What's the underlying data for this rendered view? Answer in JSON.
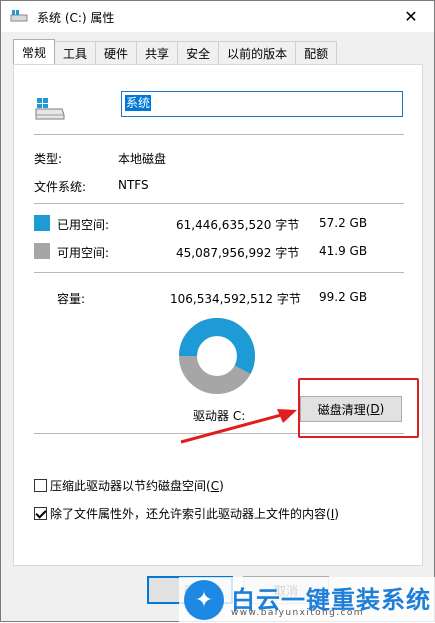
{
  "window": {
    "title": "系统 (C:) 属性",
    "close_glyph": "✕"
  },
  "tabs": [
    {
      "label": "常规",
      "active": true
    },
    {
      "label": "工具"
    },
    {
      "label": "硬件"
    },
    {
      "label": "共享"
    },
    {
      "label": "安全"
    },
    {
      "label": "以前的版本"
    },
    {
      "label": "配额"
    }
  ],
  "general": {
    "drive_name": "系统",
    "type_label": "类型:",
    "type_value": "本地磁盘",
    "fs_label": "文件系统:",
    "fs_value": "NTFS",
    "used": {
      "label": "已用空间:",
      "bytes": "61,446,635,520 字节",
      "size": "57.2 GB",
      "color": "#1e9ad6"
    },
    "free": {
      "label": "可用空间:",
      "bytes": "45,087,956,992 字节",
      "size": "41.9 GB",
      "color": "#a6a6a6"
    },
    "capacity": {
      "label": "容量:",
      "bytes": "106,534,592,512 字节",
      "size": "99.2 GB"
    },
    "used_fraction": 0.577,
    "drive_label": "驱动器 C:",
    "cleanup_button": "磁盘清理(D)",
    "compress_label": "压缩此驱动器以节约磁盘空间(C)",
    "compress_checked": false,
    "index_label": "除了文件属性外，还允许索引此驱动器上文件的内容(I)",
    "index_checked": true
  },
  "footer": {
    "ok_label": "确",
    "cancel_label": "取消"
  },
  "watermark": {
    "text": "白云一键重装系统",
    "url": "www.baiyunxitong.com"
  },
  "annotation_color": "#e01e1e"
}
